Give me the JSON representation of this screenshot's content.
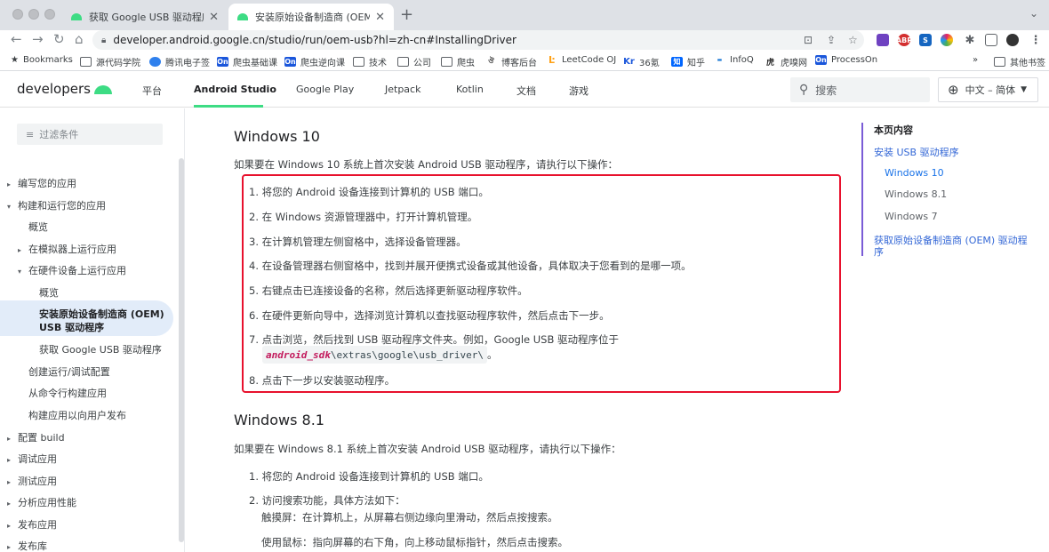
{
  "browser": {
    "tabs": [
      {
        "title": "获取 Google USB 驱动程序 | Ar",
        "close": "✕"
      },
      {
        "title": "安装原始设备制造商 (OEM) USB",
        "close": "✕"
      }
    ],
    "new_tab": "+",
    "tab_menu": "⌄",
    "url": "developer.android.google.cn/studio/run/oem-usb?hl=zh-cn#InstallingDriver",
    "extensions": [
      {
        "label": "",
        "color": "#6f42c1"
      },
      {
        "label": "ABP",
        "color": "#d32f2f"
      },
      {
        "label": "S",
        "color": "#1565c0"
      },
      {
        "label": "",
        "color": "#e91e63"
      },
      {
        "label": "",
        "color": "#5f6368"
      },
      {
        "label": "",
        "color": "#5f6368"
      },
      {
        "label": "",
        "color": "#333333"
      }
    ],
    "bookmarks": [
      {
        "label": "Bookmarks",
        "icon": "star-icon"
      },
      {
        "label": "源代码学院",
        "icon": "folder-icon"
      },
      {
        "label": "腾讯电子签",
        "icon": "cloud-icon"
      },
      {
        "label": "爬虫基础课",
        "icon": "On"
      },
      {
        "label": "爬虫逆向课",
        "icon": "On"
      },
      {
        "label": "技术",
        "icon": "folder-icon"
      },
      {
        "label": "公司",
        "icon": "folder-icon"
      },
      {
        "label": "爬虫",
        "icon": "folder-icon"
      },
      {
        "label": "博客后台",
        "icon": "bird-icon"
      },
      {
        "label": "LeetCode OJ",
        "icon": "leetcode-icon"
      },
      {
        "label": "36氪",
        "icon": "Kr"
      },
      {
        "label": "知乎",
        "icon": "知"
      },
      {
        "label": "InfoQ",
        "icon": "infoq-icon"
      },
      {
        "label": "虎嗅网",
        "icon": "huxiu-icon"
      },
      {
        "label": "ProcessOn",
        "icon": "On"
      }
    ],
    "bookmarks_overflow": "»",
    "other_bookmarks": "其他书签"
  },
  "header": {
    "logo": "developers",
    "nav": [
      "平台",
      "Android Studio",
      "Google Play",
      "Jetpack",
      "Kotlin",
      "文档",
      "游戏"
    ],
    "search_placeholder": "搜索",
    "language": "中文 – 简体"
  },
  "sidebar": {
    "filter_placeholder": "过滤条件",
    "items": [
      {
        "label": "编写您的应用",
        "arrow": "▸"
      },
      {
        "label": "构建和运行您的应用",
        "arrow": "▾"
      },
      {
        "label": "概览",
        "arrow": ""
      },
      {
        "label": "在模拟器上运行应用",
        "arrow": "▸"
      },
      {
        "label": "在硬件设备上运行应用",
        "arrow": "▾"
      },
      {
        "label": "概览",
        "arrow": ""
      },
      {
        "label": "获取 Google USB 驱动程序",
        "arrow": ""
      },
      {
        "label": "创建运行/调试配置",
        "arrow": ""
      },
      {
        "label": "从命令行构建应用",
        "arrow": ""
      },
      {
        "label": "构建应用以向用户发布",
        "arrow": ""
      },
      {
        "label": "配置 build",
        "arrow": "▸"
      },
      {
        "label": "调试应用",
        "arrow": "▸"
      },
      {
        "label": "测试应用",
        "arrow": "▸"
      },
      {
        "label": "分析应用性能",
        "arrow": "▸"
      },
      {
        "label": "发布应用",
        "arrow": "▸"
      },
      {
        "label": "发布库",
        "arrow": "▸"
      }
    ],
    "selected_line1": "安装原始设备制造商 (OEM)",
    "selected_line2": "USB 驱动程序"
  },
  "main": {
    "win10": {
      "heading": "Windows 10",
      "intro": "如果要在 Windows 10 系统上首次安装 Android USB 驱动程序，请执行以下操作：",
      "steps": [
        "1. 将您的 Android 设备连接到计算机的 USB 端口。",
        "2. 在 Windows 资源管理器中，打开计算机管理。",
        "3. 在计算机管理左侧窗格中，选择设备管理器。",
        "4. 在设备管理器右侧窗格中，找到并展开便携式设备或其他设备，具体取决于您看到的是哪一项。",
        "5. 右键点击已连接设备的名称，然后选择更新驱动程序软件。",
        "6. 在硬件更新向导中，选择浏览计算机以查找驱动程序软件，然后点击下一步。",
        "7. 点击浏览，然后找到 USB 驱动程序文件夹。例如，Google USB 驱动程序位于",
        "8. 点击下一步以安装驱动程序。"
      ],
      "code_var": "android_sdk",
      "code_rest": "\\extras\\google\\usb_driver\\",
      "code_suffix": "。"
    },
    "win81": {
      "heading": "Windows 8.1",
      "intro": "如果要在 Windows 8.1 系统上首次安装 Android USB 驱动程序，请执行以下操作：",
      "steps": [
        "1. 将您的 Android 设备连接到计算机的 USB 端口。",
        "2. 访问搜索功能，具体方法如下：",
        "触摸屏：在计算机上，从屏幕右侧边缘向里滑动，然后点按搜索。",
        "使用鼠标：指向屏幕的右下角，向上移动鼠标指针，然后点击搜索。"
      ]
    }
  },
  "toc": {
    "title": "本页内容",
    "items": [
      "安装 USB 驱动程序",
      "Windows 10",
      "Windows 8.1",
      "Windows 7",
      "获取原始设备制造商 (OEM) 驱动程",
      "序"
    ]
  },
  "colors": {
    "android_green": "#3ddc84",
    "highlight_box": "#e8112d",
    "toc_border": "#7a5cd6",
    "selected_bg": "#e2ecf9",
    "link": "#3367d6"
  }
}
